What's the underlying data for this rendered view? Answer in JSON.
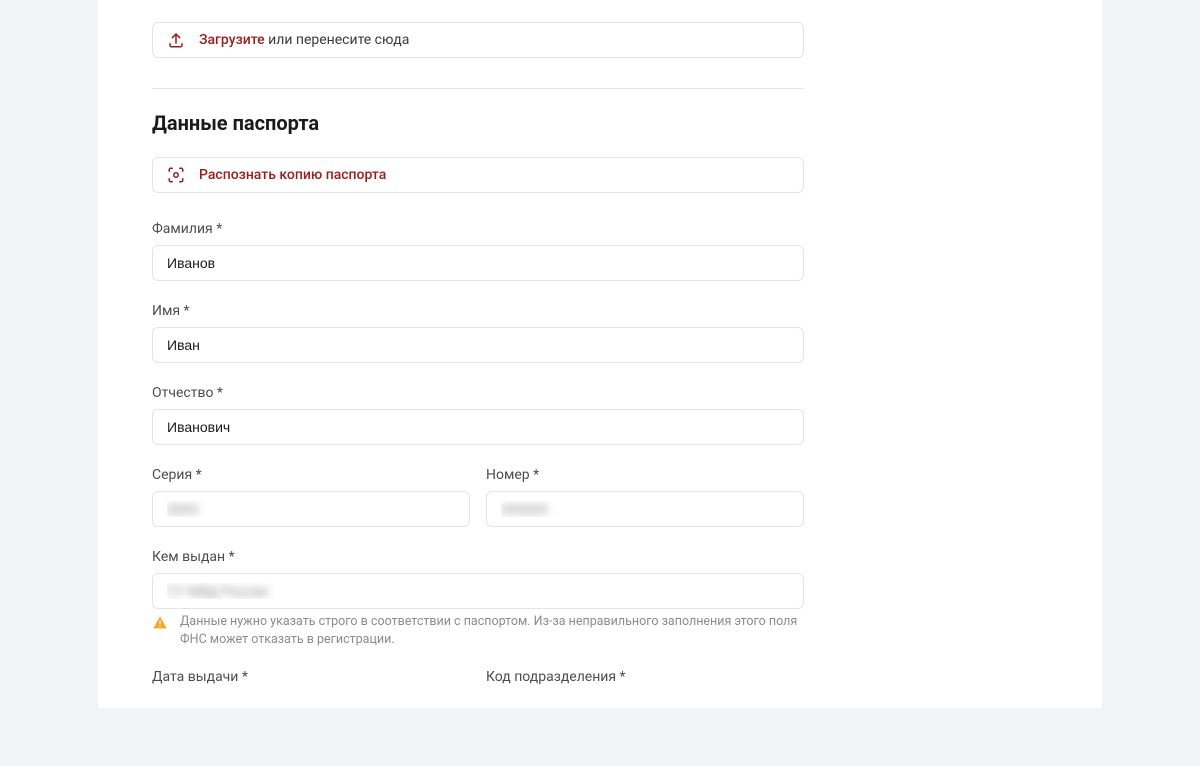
{
  "upload": {
    "accent": "Загрузите",
    "rest": " или перенесите сюда"
  },
  "section": {
    "title": "Данные паспорта"
  },
  "recognize": {
    "label": "Распознать копию паспорта"
  },
  "fields": {
    "surname": {
      "label": "Фамилия *",
      "value": "Иванов"
    },
    "name": {
      "label": "Имя *",
      "value": "Иван"
    },
    "patronymic": {
      "label": "Отчество *",
      "value": "Иванович"
    },
    "series": {
      "label": "Серия *",
      "value": "0000"
    },
    "number": {
      "label": "Номер *",
      "value": "000000"
    },
    "issued_by": {
      "label": "Кем выдан *",
      "value": "ГУ МВД России"
    },
    "issue_date": {
      "label": "Дата выдачи *"
    },
    "dept_code": {
      "label": "Код подразделения *"
    }
  },
  "warning": {
    "text": "Данные нужно указать строго в соответствии с паспортом. Из-за неправильного заполнения этого поля ФНС может отказать в регистрации."
  }
}
